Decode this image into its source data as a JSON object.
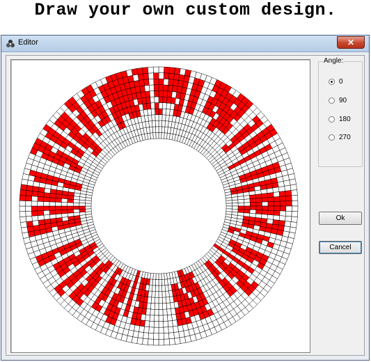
{
  "heading": "Draw your own custom design.",
  "window": {
    "title": "Editor",
    "close_label": "✕"
  },
  "angle_group": {
    "label": "Angle:",
    "options": [
      "0",
      "90",
      "180",
      "270"
    ],
    "selected": "0"
  },
  "buttons": {
    "ok": "Ok",
    "cancel": "Cancel"
  },
  "grid": {
    "rings": 12,
    "segments": 160,
    "fill_color": "#ff0000",
    "empty_color": "#ffffff",
    "line_color": "#000000"
  }
}
